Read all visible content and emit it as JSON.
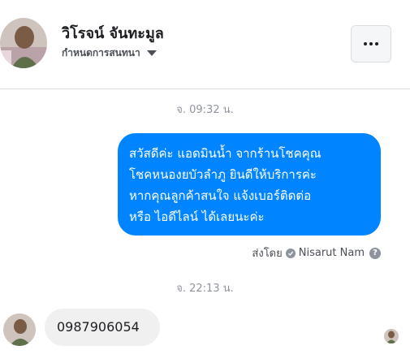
{
  "contact": {
    "name": "วิโรจน์ จันทะมูล",
    "settings_label": "กำหนดการสนทนา"
  },
  "icons": {
    "more": "more-dots-icon",
    "caret": "caret-down-icon",
    "verified": "check-circle-icon",
    "help": "help-question-icon"
  },
  "colors": {
    "outgoing_bubble": "#0084ff",
    "incoming_bubble": "#f1f0f0",
    "meta_text": "#90949c"
  },
  "messages": [
    {
      "timestamp": "จ. 09:32 น.",
      "direction": "outgoing",
      "lines": [
        "สวัสดีค่ะ แอดมินน้ำ จากร้านโชคคุณ",
        "โชคหนองยบัวลำภู ยินดีให้บริการค่ะ",
        "หากคุณลูกค้าสนใจ แจ้งเบอร์ติดต่อ",
        "หรือ ไอดีไลน์ ได้เลยนะค่ะ"
      ],
      "sent_by_label": "ส่งโดย",
      "sender": "Nisarut Nam"
    },
    {
      "timestamp": "จ. 22:13 น.",
      "direction": "incoming",
      "text": "0987906054"
    }
  ]
}
